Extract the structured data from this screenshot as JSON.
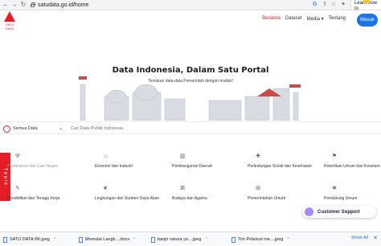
{
  "browser": {
    "url": "satudata.go.id/home",
    "learn_popup": "Learn how to"
  },
  "header": {
    "logo_text": "SATU DATA",
    "nav": [
      "Beranda",
      "Dataset",
      "Media ▾",
      "Tentang"
    ],
    "login_label": "Masuk"
  },
  "hero": {
    "title": "Data Indonesia, Dalam Satu Portal",
    "subtitle": "Temukan data-data Pemerintah dengan mudah!"
  },
  "search": {
    "category": "Semua Data",
    "placeholder": "Cari Data Publik Indonesia"
  },
  "topics": {
    "tab_label": "Topik",
    "items": [
      {
        "label": "Pertahanan dan Luar Negeri",
        "icon": "shield-icon"
      },
      {
        "label": "Ekonomi dan Industri",
        "icon": "factory-icon"
      },
      {
        "label": "Pembangunan Daerah",
        "icon": "building-icon"
      },
      {
        "label": "Perlindungan Sosial dan Kesehatan",
        "icon": "health-icon"
      },
      {
        "label": "Ketertiban Umum dan Keselamatan",
        "icon": "police-icon"
      },
      {
        "label": "Pendidikan dan Tenaga Kerja",
        "icon": "education-icon"
      },
      {
        "label": "Lingkungan dan Sumber Daya Alam",
        "icon": "leaf-icon"
      },
      {
        "label": "Budaya dan Agama",
        "icon": "culture-icon"
      },
      {
        "label": "Pemerintahan Umum",
        "icon": "government-icon"
      },
      {
        "label": "Pendukung Umum",
        "icon": "support-icon"
      }
    ]
  },
  "support": {
    "label": "Customer Support"
  },
  "downloads": {
    "items": [
      "SATU DATA INI.jpeg",
      "Memulai Langk....docx",
      "banjir natura yo....jpeg",
      "Tim Polairud me....jpeg"
    ],
    "show_all": "Show All"
  },
  "colors": {
    "brand_red": "#e31e24",
    "accent_blue": "#1a73e8"
  }
}
